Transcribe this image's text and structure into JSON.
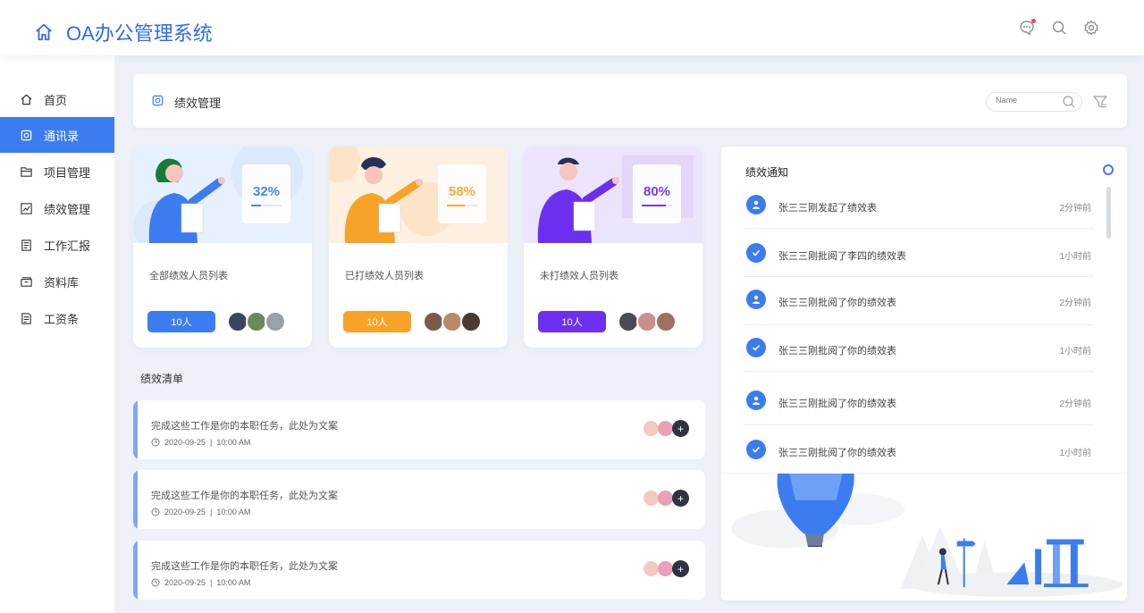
{
  "app": {
    "title": "OA办公管理系统"
  },
  "header": {
    "icons": [
      "message-icon",
      "search-icon",
      "settings-icon"
    ]
  },
  "sidebar": {
    "items": [
      {
        "label": "首页",
        "icon": "home-icon",
        "active": false
      },
      {
        "label": "通讯录",
        "icon": "contacts-icon",
        "active": true
      },
      {
        "label": "项目管理",
        "icon": "project-icon",
        "active": false
      },
      {
        "label": "绩效管理",
        "icon": "chart-icon",
        "active": false
      },
      {
        "label": "工作汇报",
        "icon": "report-icon",
        "active": false
      },
      {
        "label": "资料库",
        "icon": "archive-icon",
        "active": false
      },
      {
        "label": "工资条",
        "icon": "payslip-icon",
        "active": false
      }
    ]
  },
  "page": {
    "title": "绩效管理",
    "search_placeholder": "Name"
  },
  "cards": [
    {
      "percent": "32%",
      "progress": 0.32,
      "label": "全部绩效人员列表",
      "count": "10人",
      "color": "#3b7df0"
    },
    {
      "percent": "58%",
      "progress": 0.58,
      "label": "已打绩效人员列表",
      "count": "10人",
      "color": "#f7a32a"
    },
    {
      "percent": "80%",
      "progress": 0.8,
      "label": "未打绩效人员列表",
      "count": "10人",
      "color": "#6c2ff0"
    }
  ],
  "tasks": {
    "title": "绩效清单",
    "items": [
      {
        "text": "完成这些工作是你的本职任务，此处为文案",
        "date": "2020-09-25",
        "time": "10:00 AM",
        "add": "+"
      },
      {
        "text": "完成这些工作是你的本职任务，此处为文案",
        "date": "2020-09-25",
        "time": "10:00 AM",
        "add": "+"
      },
      {
        "text": "完成这些工作是你的本职任务，此处为文案",
        "date": "2020-09-25",
        "time": "10:00 AM",
        "add": "+"
      }
    ]
  },
  "notices": {
    "title": "绩效通知",
    "items": [
      {
        "text": "张三三刚发起了绩效表",
        "time": "2分钟前",
        "icon": "user-icon"
      },
      {
        "text": "张三三刚批阅了李四的绩效表",
        "time": "1小时前",
        "icon": "check-icon"
      },
      {
        "text": "张三三刚批阅了你的绩效表",
        "time": "2分钟前",
        "icon": "user-icon"
      },
      {
        "text": "张三三刚批阅了你的绩效表",
        "time": "1小时前",
        "icon": "check-icon"
      },
      {
        "text": "张三三刚批阅了你的绩效表",
        "time": "2分钟前",
        "icon": "user-icon"
      },
      {
        "text": "张三三刚批阅了你的绩效表",
        "time": "1小时前",
        "icon": "check-icon"
      }
    ]
  }
}
